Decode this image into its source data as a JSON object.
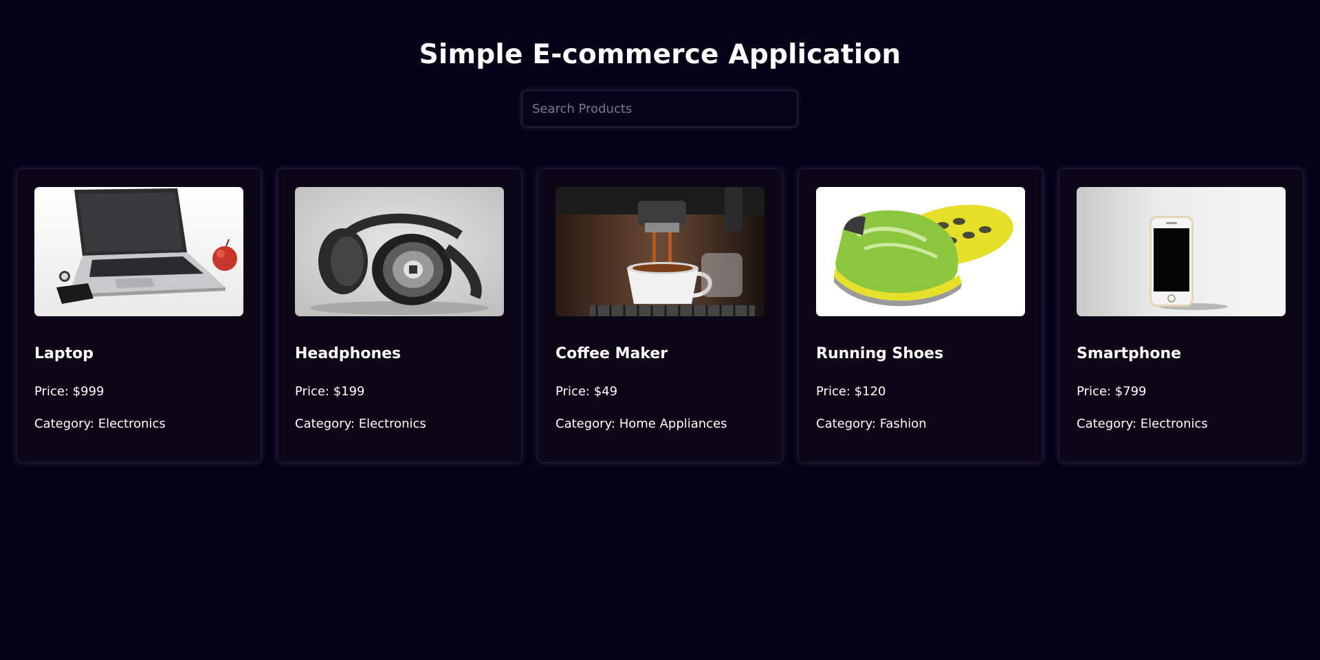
{
  "page": {
    "title": "Simple E-commerce Application",
    "search_placeholder": "Search Products"
  },
  "labels": {
    "price_prefix": "Price: ",
    "category_prefix": "Category: "
  },
  "products": [
    {
      "name": "Laptop",
      "price": "$999",
      "category": "Electronics",
      "image_icon": "laptop-image"
    },
    {
      "name": "Headphones",
      "price": "$199",
      "category": "Electronics",
      "image_icon": "headphones-image"
    },
    {
      "name": "Coffee Maker",
      "price": "$49",
      "category": "Home Appliances",
      "image_icon": "coffee-maker-image"
    },
    {
      "name": "Running Shoes",
      "price": "$120",
      "category": "Fashion",
      "image_icon": "running-shoes-image"
    },
    {
      "name": "Smartphone",
      "price": "$799",
      "category": "Electronics",
      "image_icon": "smartphone-image"
    }
  ],
  "colors": {
    "background": "#030217",
    "card": "#0d0617",
    "text": "#ffffff",
    "placeholder": "#7a7988"
  }
}
